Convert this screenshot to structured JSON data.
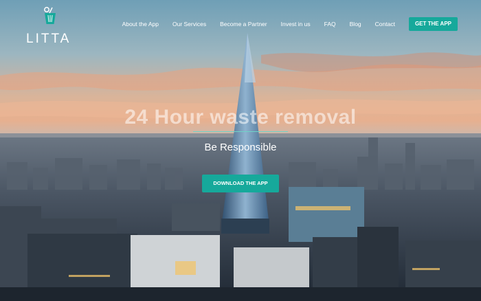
{
  "brand": {
    "name": "LITTA"
  },
  "nav": {
    "items": [
      "About the App",
      "Our Services",
      "Become a Partner",
      "Invest in us",
      "FAQ",
      "Blog",
      "Contact"
    ],
    "cta": "GET THE APP"
  },
  "hero": {
    "headline": "24 Hour waste removal",
    "tagline": "Be Responsible",
    "button": "DOWNLOAD THE APP"
  },
  "colors": {
    "accent": "#16a99b",
    "text": "#ffffff"
  },
  "icons": {
    "logo": "litta-bin-logo-icon"
  }
}
